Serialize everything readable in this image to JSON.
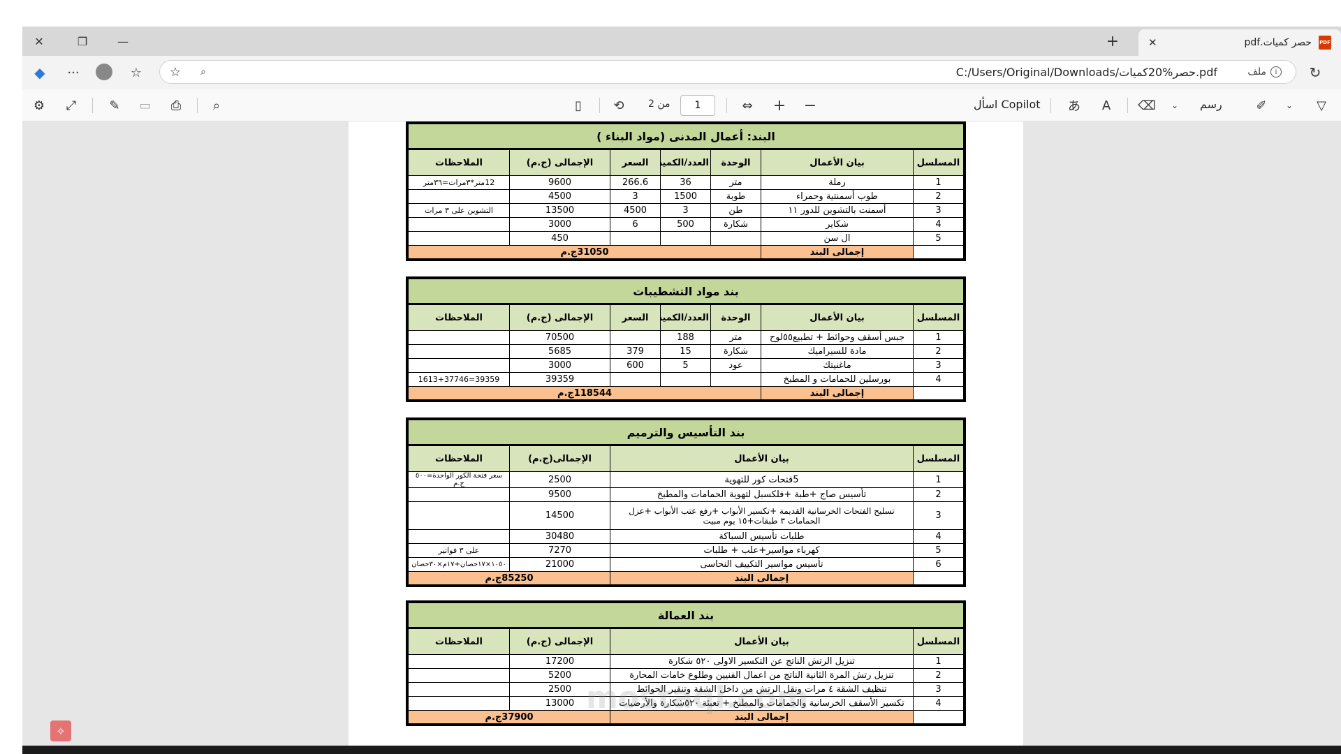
{
  "tab": {
    "title": "حصر كميات.pdf",
    "icon": "pdf-icon"
  },
  "address": {
    "url": "C:/Users/Original/Downloads/حصر%20كميات.pdf",
    "file_label": "ملف"
  },
  "toolbar": {
    "page_current": "1",
    "page_of": "من 2",
    "copilot": "اسأل Copilot",
    "draw": "رسم"
  },
  "watermark": "mostaql.com",
  "block1": {
    "title": "البند: أعمال المدنى (مواد البناء )",
    "headers": [
      "المسلسل",
      "بيان الأعمال",
      "الوحدة",
      "العدد/الكمية",
      "السعر",
      "الإجمالى (ج.م)",
      "الملاحظات"
    ],
    "rows": [
      [
        "1",
        "رملة",
        "متر",
        "36",
        "266.6",
        "9600",
        "12متر*٣مرات=٣٦متر"
      ],
      [
        "2",
        "طوب أسمنتية وحمراء",
        "طوبة",
        "1500",
        "3",
        "4500",
        ""
      ],
      [
        "3",
        "أسمنت بالتشوين للدور ١١",
        "طن",
        "3",
        "4500",
        "13500",
        "التشوين على ٣ مرات"
      ],
      [
        "4",
        "شكاير",
        "شكارة",
        "500",
        "6",
        "3000",
        ""
      ],
      [
        "5",
        "ال سن",
        "",
        "",
        "",
        "450",
        ""
      ]
    ],
    "total_label": "إجمالى البند",
    "total_value": "31050ج.م"
  },
  "block2": {
    "title": "بند مواد التشطيبات",
    "headers": [
      "المسلسل",
      "بيان الأعمال",
      "الوحدة",
      "العدد/الكمية",
      "السعر",
      "الإجمالى (ج.م)",
      "الملاحظات"
    ],
    "rows": [
      [
        "1",
        "جبس أسقف وحوائط + تطبيع٥٥لوح",
        "متر",
        "188",
        "",
        "70500",
        ""
      ],
      [
        "2",
        "مادة للسيراميك",
        "شكارة",
        "15",
        "379",
        "5685",
        ""
      ],
      [
        "3",
        "ماغنيتك",
        "عود",
        "5",
        "600",
        "3000",
        ""
      ],
      [
        "4",
        "بورسلين للحمامات و المطبخ",
        "",
        "",
        "",
        "39359",
        "39359=1613+37746"
      ]
    ],
    "total_label": "إجمالى البند",
    "total_value": "118544ج.م"
  },
  "block3": {
    "title": "بند التأسيس والترميم",
    "headers": [
      "المسلسل",
      "بيان الأعمال",
      "الإجمالى(ج.م)",
      "الملاحظات"
    ],
    "rows": [
      [
        "1",
        "5فتحات كور للتهوية",
        "2500",
        "سعر فتحة الكور الواحدة=٥٠٠ ج.م"
      ],
      [
        "2",
        "تأسيس صاج +طبة +فلكسبل لتهوية الحمامات والمطبخ",
        "9500",
        ""
      ],
      [
        "3",
        "تسليح الفتحات الخرسانية القديمة +تكسير الأبواب +رفع عتب الأبواب +عزل الحمامات ٣ طبقات+١٥ يوم مبيت",
        "14500",
        ""
      ],
      [
        "4",
        "طلبات تأسيس السباكة",
        "30480",
        ""
      ],
      [
        "5",
        "كهرباء مواسير+علب + طلبات",
        "7270",
        "على ٣ فواتير"
      ],
      [
        "6",
        "تأسيس مواسير التكييف النحاسى",
        "21000",
        "١٠٥٠×١٧حصان+١٧م×٣٠حصان"
      ]
    ],
    "total_label": "إجمالى البند",
    "total_value": "85250ج.م"
  },
  "block4": {
    "title": "بند العمالة",
    "headers": [
      "المسلسل",
      "بيان الأعمال",
      "الإجمالى (ج.م)",
      "الملاحظات"
    ],
    "rows": [
      [
        "1",
        "تنزيل الرتش الناتج عن التكسير الاولى ٥٢٠ شكارة",
        "17200",
        ""
      ],
      [
        "2",
        "تنزيل رتش المرة الثانية الناتج من اعمال الفنيين وطلوع خامات المحارة",
        "5200",
        ""
      ],
      [
        "3",
        "تنظيف الشقة ٤ مرات ونقل الرتش من داخل الشقة وتنقير الحوائط",
        "2500",
        ""
      ],
      [
        "4",
        "تكسير الأسقف الخرسانية والحمامات والمطبخ + تعبئة ٥٢٠شكارة والأرضيات",
        "13000",
        ""
      ]
    ],
    "total_label": "إجمالى البند",
    "total_value": "37900ج.م"
  }
}
